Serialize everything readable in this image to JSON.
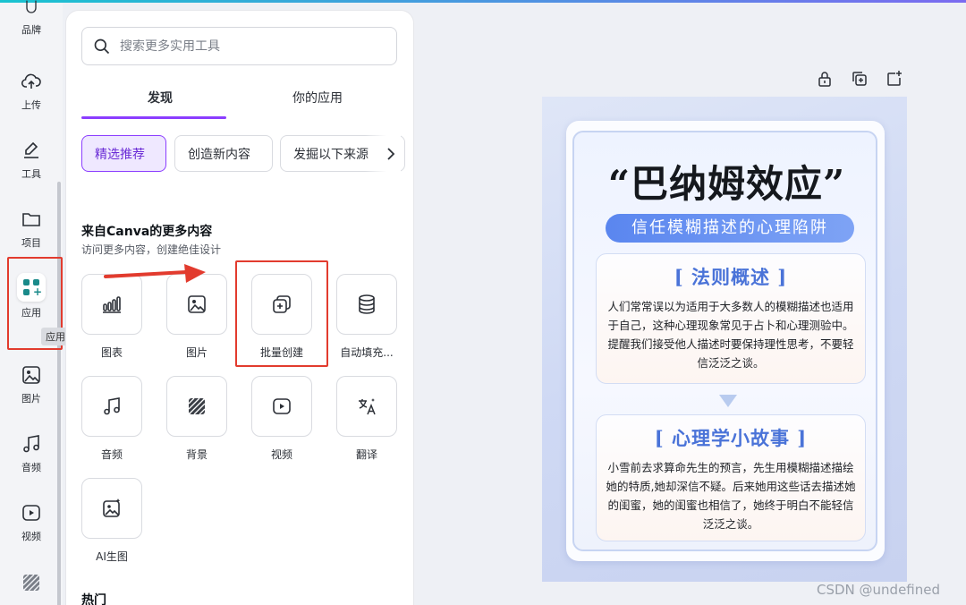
{
  "rail": {
    "items": [
      {
        "label": "品牌",
        "icon": "brand-icon"
      },
      {
        "label": "上传",
        "icon": "cloud-upload-icon"
      },
      {
        "label": "工具",
        "icon": "pen-tool-icon"
      },
      {
        "label": "项目",
        "icon": "folder-icon"
      },
      {
        "label": "应用",
        "icon": "apps-icon"
      },
      {
        "label": "图片",
        "icon": "image-icon"
      },
      {
        "label": "音频",
        "icon": "music-note-icon"
      },
      {
        "label": "视频",
        "icon": "video-play-icon"
      }
    ],
    "tooltip": "应用"
  },
  "panel": {
    "search_placeholder": "搜索更多实用工具",
    "tabs": [
      "发现",
      "你的应用"
    ],
    "chips": [
      "精选推荐",
      "创造新内容",
      "发掘以下来源"
    ],
    "section_title": "来自Canva的更多内容",
    "section_sub": "访问更多内容，创建绝佳设计",
    "tiles": [
      {
        "label": "图表",
        "icon": "chart-icon"
      },
      {
        "label": "图片",
        "icon": "image-icon"
      },
      {
        "label": "批量创建",
        "icon": "bulk-create-icon"
      },
      {
        "label": "自动填充...",
        "icon": "database-icon"
      },
      {
        "label": "音频",
        "icon": "music-note-icon"
      },
      {
        "label": "背景",
        "icon": "pattern-icon"
      },
      {
        "label": "视频",
        "icon": "video-play-icon"
      },
      {
        "label": "翻译",
        "icon": "translate-icon"
      },
      {
        "label": "AI生图",
        "icon": "ai-image-icon"
      }
    ],
    "hot_title": "热门"
  },
  "poster": {
    "title": "“巴纳姆效应”",
    "subtitle": "信任模糊描述的心理陷阱",
    "box1_title": "[ 法则概述 ]",
    "box1_text": "人们常常误以为适用于大多数人的模糊描述也适用于自己，这种心理现象常见于占卜和心理测验中。提醒我们接受他人描述时要保持理性思考，不要轻信泛泛之谈。",
    "box2_title": "[ 心理学小故事 ]",
    "box2_text": "小雪前去求算命先生的预言，先生用模糊描述描绘她的特质,她却深信不疑。后来她用这些话去描述她的闺蜜，她的闺蜜也相信了，她终于明白不能轻信泛泛之谈。"
  },
  "toolbar_icons": [
    "lock-icon",
    "duplicate-icon",
    "add-page-icon"
  ],
  "watermark": "CSDN @undefined",
  "colors": {
    "accent": "#8b3dff",
    "highlight": "#e23b2e",
    "poster_blue": "#4a73d8"
  }
}
